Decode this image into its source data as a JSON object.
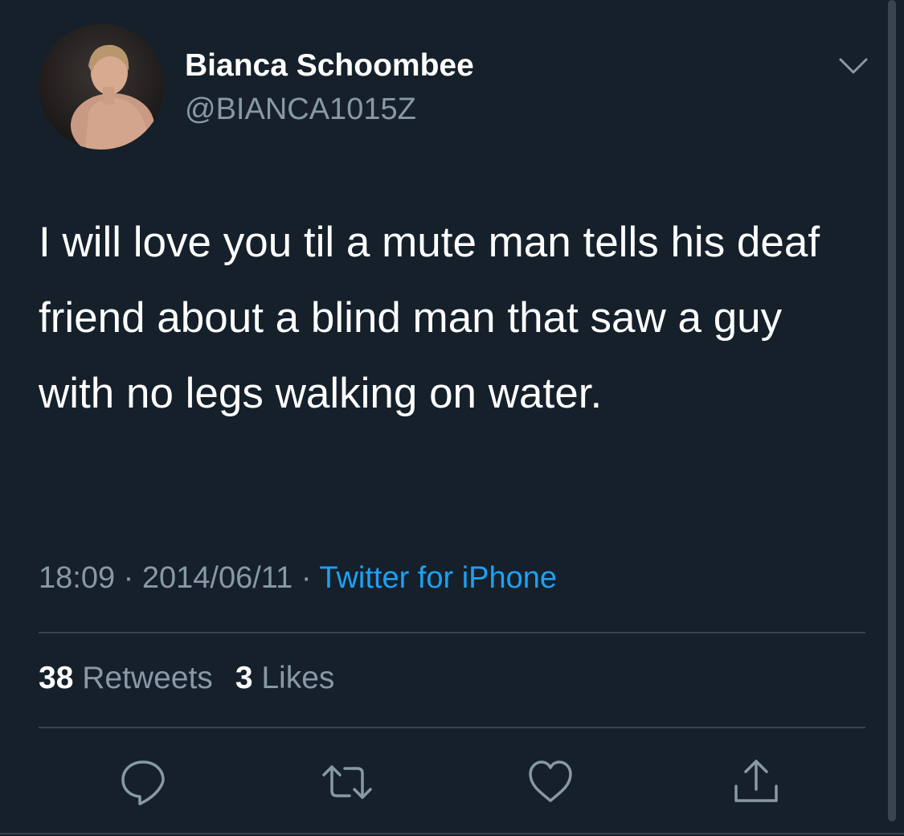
{
  "author": {
    "display_name": "Bianca Schoombee",
    "handle": "@BIANCA1015Z"
  },
  "tweet": {
    "text": "I will love you til a mute man tells his deaf friend about a blind man that saw a guy with no legs walking on water."
  },
  "meta": {
    "time": "18:09",
    "separator": "·",
    "date": "2014/06/11",
    "source": "Twitter for iPhone"
  },
  "stats": {
    "retweets_count": "38",
    "retweets_label": "Retweets",
    "likes_count": "3",
    "likes_label": "Likes"
  },
  "icons": {
    "more": "chevron-down-icon",
    "reply": "reply-icon",
    "retweet": "retweet-icon",
    "like": "heart-icon",
    "share": "share-icon"
  },
  "colors": {
    "background": "#15202b",
    "primary_text": "#ffffff",
    "secondary_text": "#8899a6",
    "link": "#1da1f2",
    "divider": "#38444d"
  }
}
